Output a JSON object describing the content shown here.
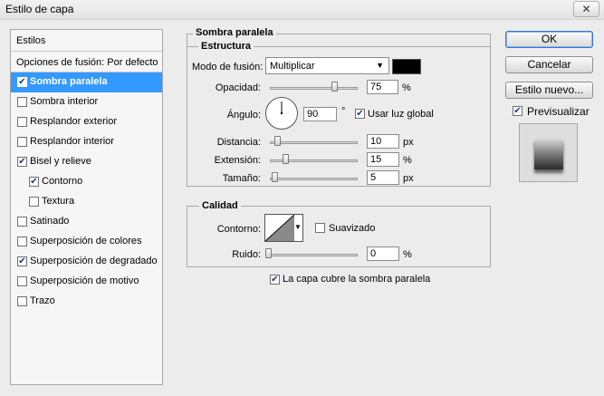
{
  "window": {
    "title": "Estilo de capa",
    "close_glyph": "✕"
  },
  "left_panel": {
    "header": "Estilos",
    "blend_options": "Opciones de fusión: Por defecto",
    "items": [
      {
        "label": "Sombra paralela",
        "checked": true,
        "selected": true,
        "indent": false
      },
      {
        "label": "Sombra interior",
        "checked": false,
        "selected": false,
        "indent": false
      },
      {
        "label": "Resplandor exterior",
        "checked": false,
        "selected": false,
        "indent": false
      },
      {
        "label": "Resplandor interior",
        "checked": false,
        "selected": false,
        "indent": false
      },
      {
        "label": "Bisel y relieve",
        "checked": true,
        "selected": false,
        "indent": false
      },
      {
        "label": "Contorno",
        "checked": true,
        "selected": false,
        "indent": true
      },
      {
        "label": "Textura",
        "checked": false,
        "selected": false,
        "indent": true
      },
      {
        "label": "Satinado",
        "checked": false,
        "selected": false,
        "indent": false
      },
      {
        "label": "Superposición de colores",
        "checked": false,
        "selected": false,
        "indent": false
      },
      {
        "label": "Superposición de degradado",
        "checked": true,
        "selected": false,
        "indent": false
      },
      {
        "label": "Superposición de motivo",
        "checked": false,
        "selected": false,
        "indent": false
      },
      {
        "label": "Trazo",
        "checked": false,
        "selected": false,
        "indent": false
      }
    ]
  },
  "drop_shadow": {
    "section_title": "Sombra paralela",
    "structure": {
      "title": "Estructura",
      "blend_mode_label": "Modo de fusión:",
      "blend_mode_value": "Multiplicar",
      "color": "#000000",
      "opacity_label": "Opacidad:",
      "opacity_value": "75",
      "opacity_unit": "%",
      "opacity_fraction": 0.75,
      "angle_label": "Ángulo:",
      "angle_value": "90",
      "angle_unit": "°",
      "global_light_label": "Usar luz global",
      "global_light_checked": true,
      "distance_label": "Distancia:",
      "distance_value": "10",
      "distance_unit": "px",
      "distance_fraction": 0.05,
      "spread_label": "Extensión:",
      "spread_value": "15",
      "spread_unit": "%",
      "spread_fraction": 0.15,
      "size_label": "Tamaño:",
      "size_value": "5",
      "size_unit": "px",
      "size_fraction": 0.02
    },
    "quality": {
      "title": "Calidad",
      "contour_label": "Contorno:",
      "anti_alias_label": "Suavizado",
      "anti_alias_checked": false,
      "noise_label": "Ruido:",
      "noise_value": "0",
      "noise_unit": "%",
      "noise_fraction": 0.0
    },
    "knockout_label": "La capa cubre la sombra paralela",
    "knockout_checked": true
  },
  "buttons": {
    "ok": "OK",
    "cancel": "Cancelar",
    "new_style": "Estilo nuevo...",
    "preview_label": "Previsualizar",
    "preview_checked": true
  },
  "check_glyph": "✔",
  "dropdown_glyph": "▼"
}
